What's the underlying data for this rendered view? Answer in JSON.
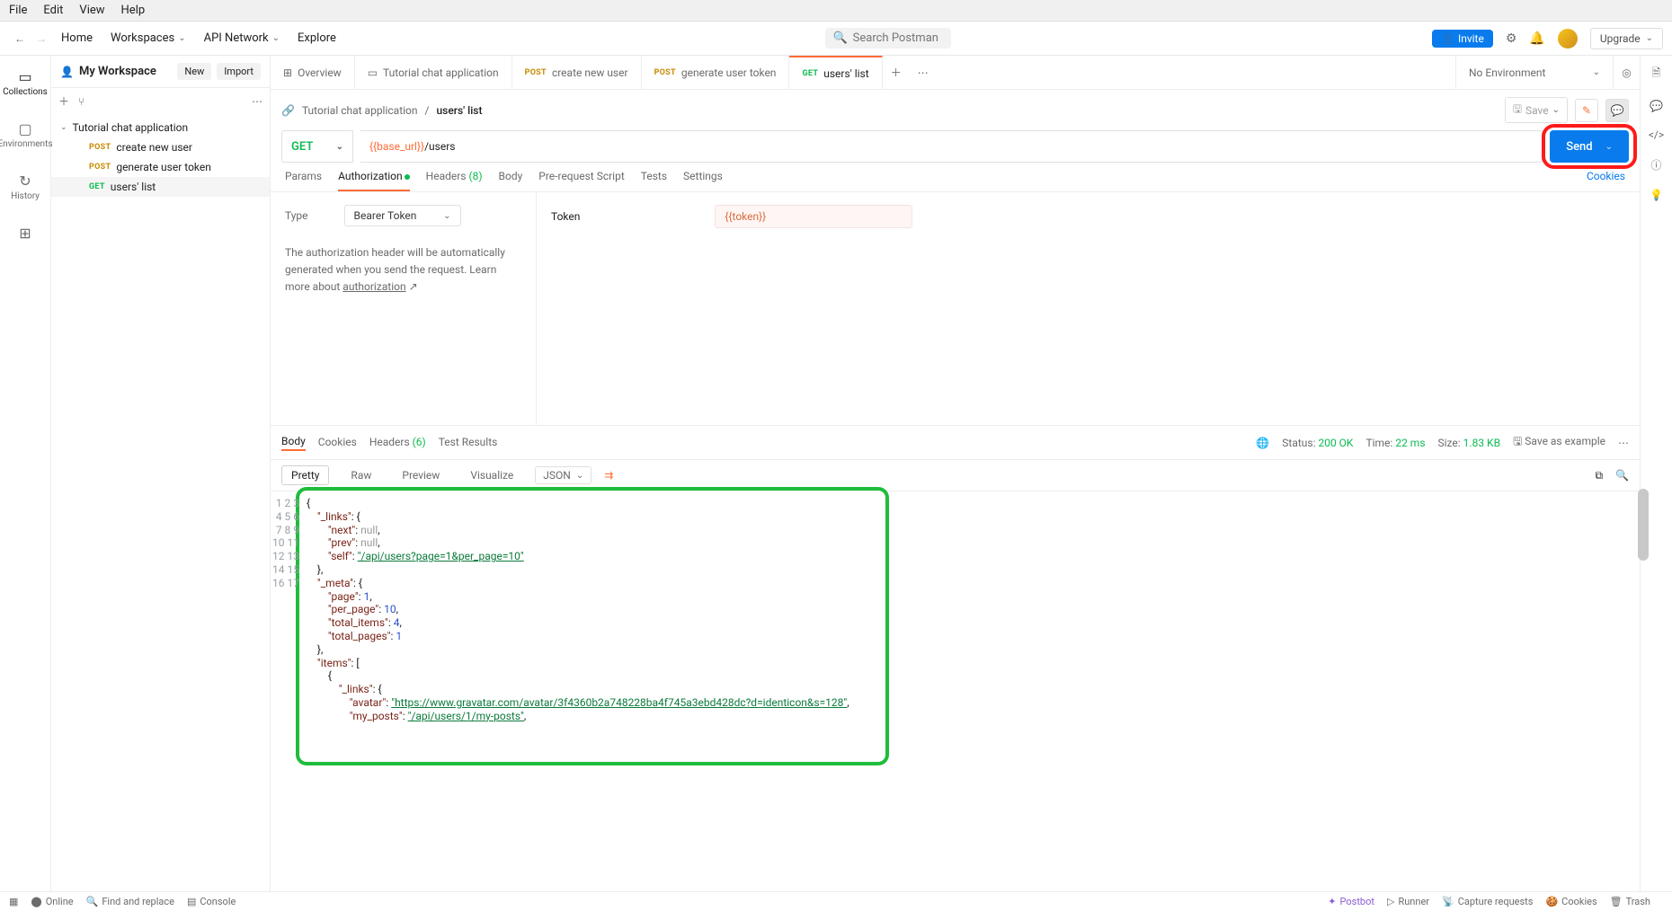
{
  "menubar": [
    "File",
    "Edit",
    "View",
    "Help"
  ],
  "topnav": {
    "home": "Home",
    "workspaces": "Workspaces",
    "api_network": "API Network",
    "explore": "Explore",
    "search_placeholder": "Search Postman",
    "invite": "Invite",
    "upgrade": "Upgrade"
  },
  "workspace_header": {
    "title": "My Workspace",
    "new": "New",
    "import": "Import"
  },
  "left_rail": [
    {
      "label": "Collections",
      "icon": "▢"
    },
    {
      "label": "Environments",
      "icon": "▭"
    },
    {
      "label": "History",
      "icon": "↻"
    }
  ],
  "tree": {
    "collection": "Tutorial chat application",
    "items": [
      {
        "method": "POST",
        "label": "create new user"
      },
      {
        "method": "POST",
        "label": "generate user token"
      },
      {
        "method": "GET",
        "label": "users' list"
      }
    ]
  },
  "tabs": [
    {
      "icon": "⊞",
      "label": "Overview"
    },
    {
      "icon": "▭",
      "label": "Tutorial chat application"
    },
    {
      "method": "POST",
      "label": "create new user"
    },
    {
      "method": "POST",
      "label": "generate user token"
    },
    {
      "method": "GET",
      "label": "users' list",
      "active": true
    }
  ],
  "env": "No Environment",
  "breadcrumb": {
    "collection": "Tutorial chat application",
    "request": "users' list"
  },
  "actions": {
    "save": "Save"
  },
  "request": {
    "method": "GET",
    "url_var": "{{base_url}}",
    "url_path": "/users",
    "send": "Send"
  },
  "req_tabs": {
    "params": "Params",
    "auth": "Authorization",
    "headers": "Headers",
    "headers_cnt": "(8)",
    "body": "Body",
    "prereq": "Pre-request Script",
    "tests": "Tests",
    "settings": "Settings",
    "cookies": "Cookies"
  },
  "auth": {
    "type_label": "Type",
    "type_value": "Bearer Token",
    "note": "The authorization header will be automatically generated when you send the request. Learn more about ",
    "note_link": "authorization",
    "token_label": "Token",
    "token_value": "{{token}}"
  },
  "resp_tabs": {
    "body": "Body",
    "cookies": "Cookies",
    "headers": "Headers",
    "headers_cnt": "(6)",
    "tests": "Test Results"
  },
  "resp_status": {
    "status_lbl": "Status:",
    "status_val": "200 OK",
    "time_lbl": "Time:",
    "time_val": "22 ms",
    "size_lbl": "Size:",
    "size_val": "1.83 KB",
    "save_example": "Save as example"
  },
  "resp_toolbar": {
    "pretty": "Pretty",
    "raw": "Raw",
    "preview": "Preview",
    "visualize": "Visualize",
    "format": "JSON"
  },
  "json_lines": [
    "{",
    "    \"_links\": {",
    "        \"next\": null,",
    "        \"prev\": null,",
    "        \"self\": \"/api/users?page=1&per_page=10\"",
    "    },",
    "    \"_meta\": {",
    "        \"page\": 1,",
    "        \"per_page\": 10,",
    "        \"total_items\": 4,",
    "        \"total_pages\": 1",
    "    },",
    "    \"items\": [",
    "        {",
    "            \"_links\": {",
    "                \"avatar\": \"https://www.gravatar.com/avatar/3f4360b2a748228ba4f745a3ebd428dc?d=identicon&s=128\",",
    "                \"my_posts\": \"/api/users/1/my-posts\","
  ],
  "statusbar": {
    "online": "Online",
    "find": "Find and replace",
    "console": "Console",
    "postbot": "Postbot",
    "runner": "Runner",
    "capture": "Capture requests",
    "cookies": "Cookies",
    "trash": "Trash"
  }
}
